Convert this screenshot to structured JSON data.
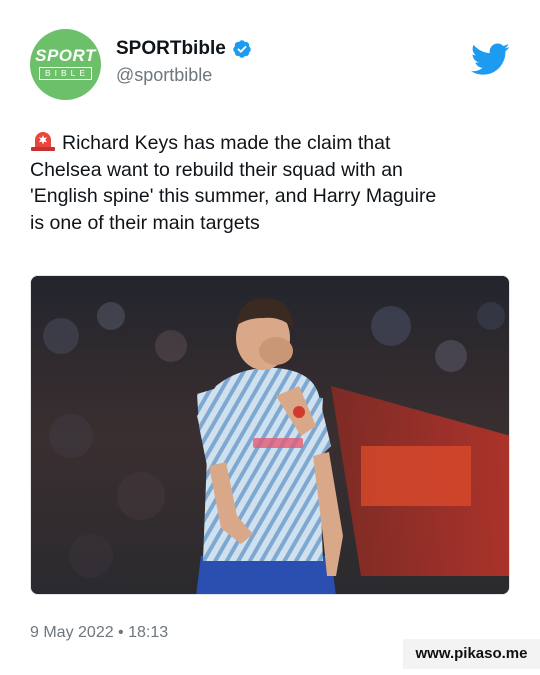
{
  "account": {
    "display_name": "SPORTbible",
    "handle": "@sportbible",
    "avatar_top": "SPORT",
    "avatar_bottom": "BIBLE",
    "verified": true
  },
  "tweet": {
    "emoji": "rotating-light-icon",
    "lines": [
      "Richard Keys has made the claim that",
      "Chelsea want to rebuild their squad with an",
      "'English spine' this summer, and Harry Maguire",
      "is one of their main targets"
    ],
    "timestamp": "9 May 2022 • 18:13"
  },
  "media": {
    "description_icon": "photo-player-icon"
  },
  "watermark": "www.pikaso.me",
  "colors": {
    "verified": "#1d9bf0",
    "twitter": "#1d9bf0",
    "avatar": "#6cc06a",
    "handle": "#6e767d"
  }
}
